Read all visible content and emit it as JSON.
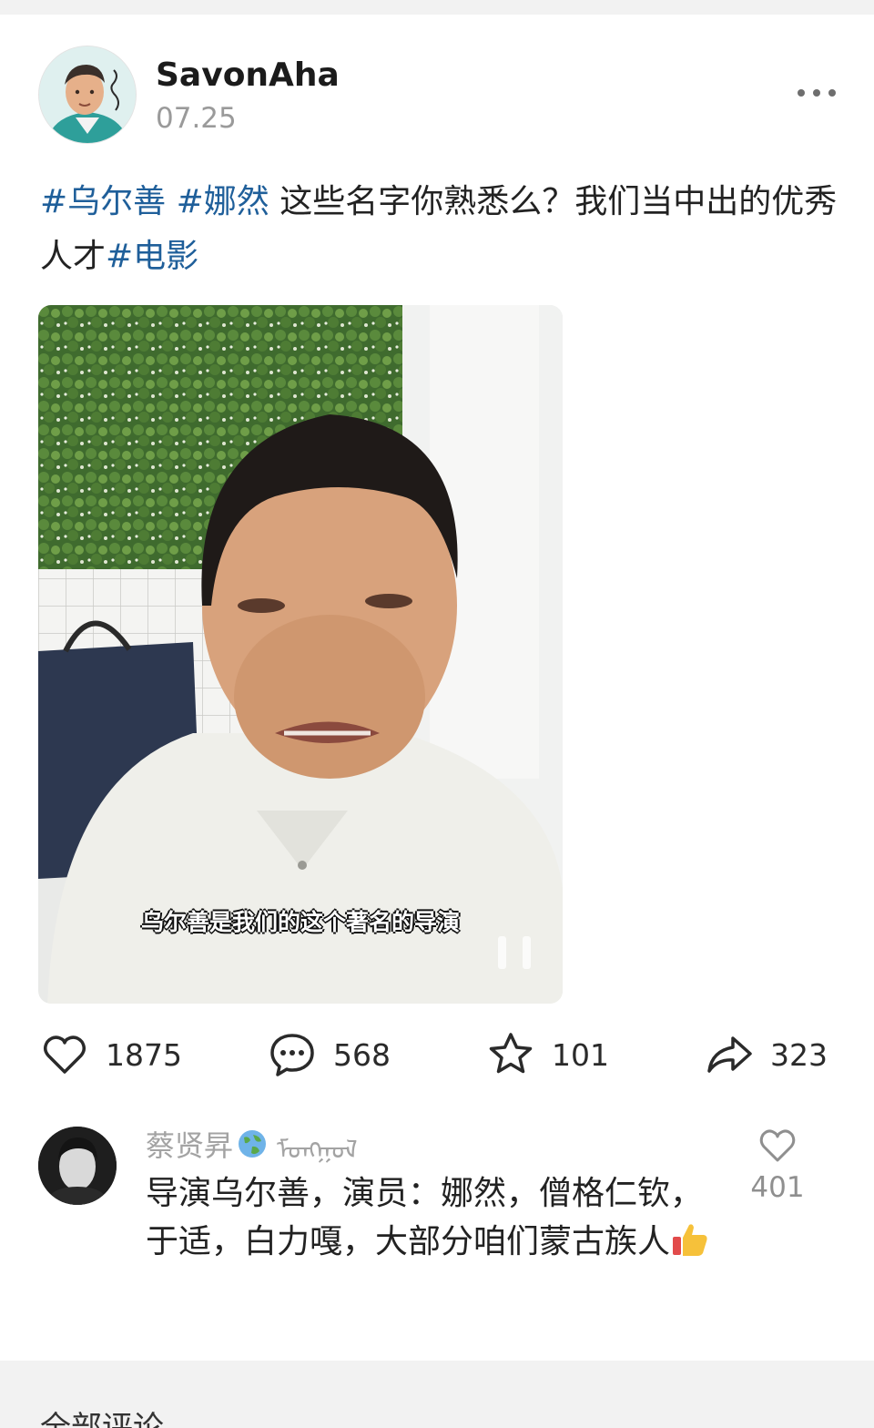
{
  "post": {
    "username": "SavonAha",
    "date": "07.25",
    "text_parts": [
      {
        "text": "#乌尔善",
        "tag": true
      },
      {
        "text": " ",
        "tag": false
      },
      {
        "text": "#娜然",
        "tag": true
      },
      {
        "text": " 这些名字你熟悉么？我们当中出的优秀人才",
        "tag": false
      },
      {
        "text": "#电影",
        "tag": true
      }
    ],
    "video": {
      "subtitle": "乌尔善是我们的这个著名的导演",
      "state": "paused"
    }
  },
  "actions": {
    "like_count": "1875",
    "comment_count": "568",
    "favorite_count": "101",
    "share_count": "323"
  },
  "comment": {
    "user": "蔡贤昇",
    "user_script": "ᠮᠣᠩᠭᠣᠯ",
    "text": "导演乌尔善，演员：娜然，僧格仁钦，于适，白力嘎，大部分咱们蒙古族人",
    "like_count": "401"
  },
  "next_section": {
    "heading": "全部评论"
  },
  "colors": {
    "hashtag": "#1f5f9a",
    "background": "#f2f2f2",
    "card": "#ffffff"
  }
}
